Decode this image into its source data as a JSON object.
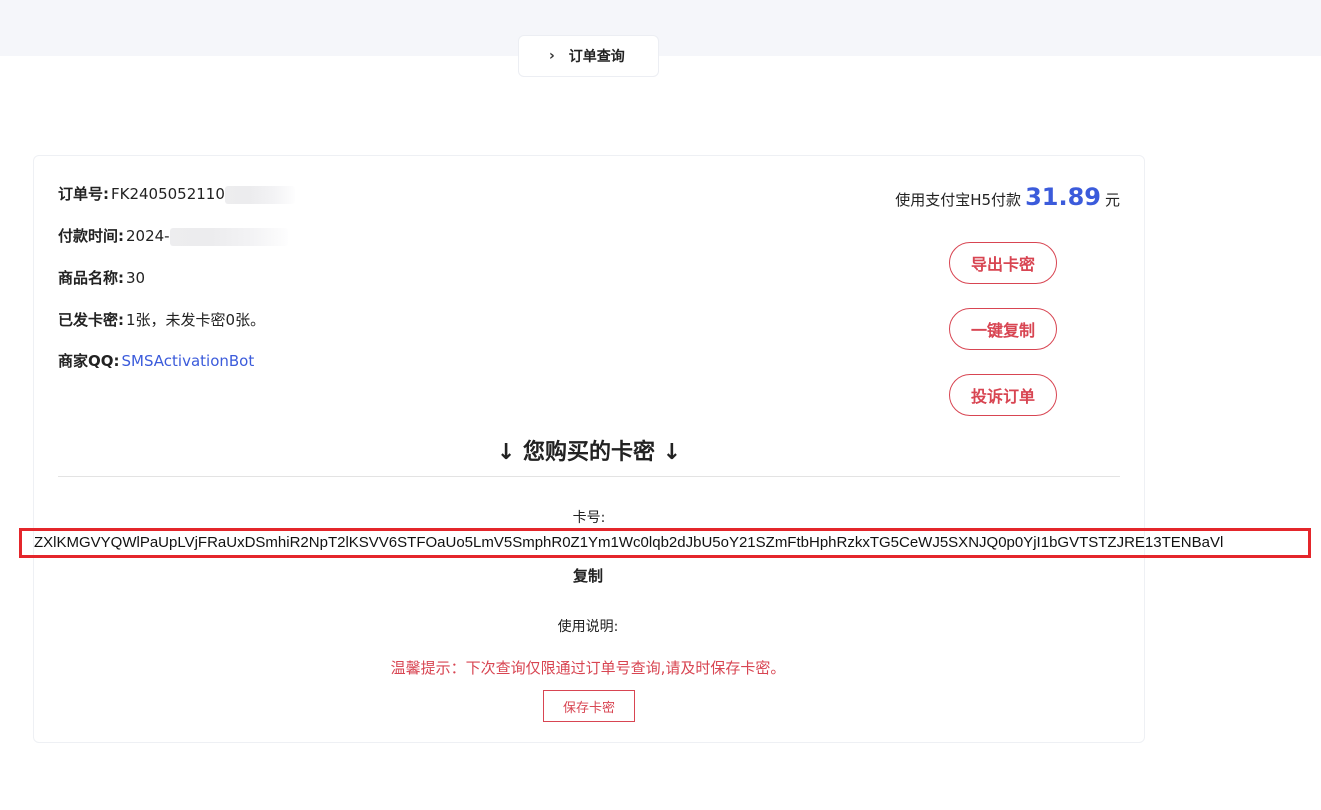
{
  "nav": {
    "tab_label": "订单查询",
    "chevron_icon": "chevron-right-icon"
  },
  "order": {
    "order_no_label": "订单号:",
    "order_no_value": "FK2405052110",
    "pay_time_label": "付款时间:",
    "pay_time_value": "2024-",
    "product_label": "商品名称:",
    "product_value": "30",
    "issued_label": "已发卡密:",
    "issued_value": "1张，未发卡密0张。",
    "merchant_label": "商家QQ:",
    "merchant_value": "SMSActivationBot"
  },
  "payment": {
    "prefix": "使用支付宝H5付款",
    "amount": "31.89",
    "unit": "元"
  },
  "actions": {
    "export": "导出卡密",
    "copy_all": "一键复制",
    "complain": "投诉订单"
  },
  "card_section": {
    "title": "↓ 您购买的卡密 ↓",
    "card_no_label": "卡号:",
    "card_value": "ZXlKMGVYQWlPaUpLVjFRaUxDSmhiR2NpT2lKSVV6STFOaUo5LmV5SmphR0Z1Ym1Wc0lqb2dJbU5oY21SZmFtbHphRzkxTG5CeWJ5SXNJQ0p0YjI1bGVTSTZJRE13TENBaVl",
    "copy_label": "复制",
    "usage_label": "使用说明:",
    "tip": "温馨提示：下次查询仅限通过订单号查询,请及时保存卡密。",
    "save_label": "保存卡密"
  },
  "colors": {
    "accent_blue": "#3b5bdb",
    "accent_red": "#d84552",
    "highlight_red": "#e4262b"
  }
}
